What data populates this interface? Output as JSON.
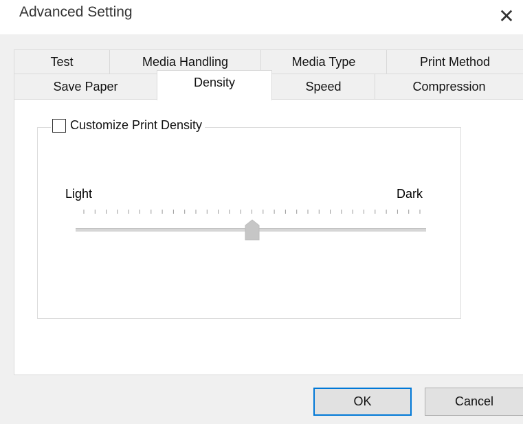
{
  "window": {
    "title": "Advanced Setting",
    "close_glyph": "✕"
  },
  "tabs": {
    "row_back": [
      {
        "label": "Test"
      },
      {
        "label": "Media Handling"
      },
      {
        "label": "Media Type"
      },
      {
        "label": "Print Method"
      }
    ],
    "row_front": [
      {
        "label": "Save Paper",
        "selected": false
      },
      {
        "label": "Density",
        "selected": true
      },
      {
        "label": "Speed",
        "selected": false
      },
      {
        "label": "Compression",
        "selected": false
      }
    ]
  },
  "density": {
    "checkbox_label": "Customize Print Density",
    "checked": false,
    "min_label": "Light",
    "max_label": "Dark",
    "tick_count": 31,
    "slider_value_fraction": 0.5,
    "enabled": false
  },
  "buttons": {
    "ok": "OK",
    "cancel": "Cancel"
  },
  "colors": {
    "accent": "#0078d7",
    "disabled_thumb": "#c6c6c6"
  }
}
